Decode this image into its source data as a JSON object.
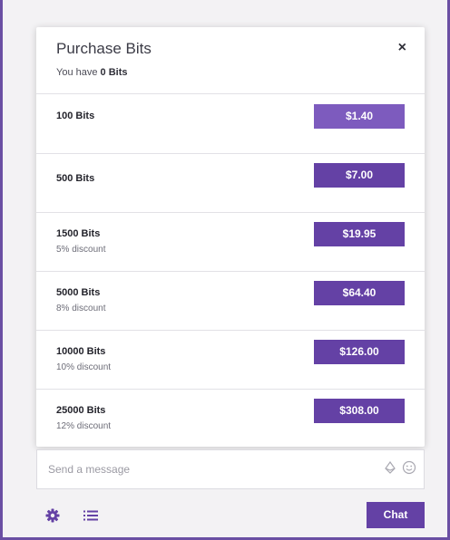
{
  "modal": {
    "title": "Purchase Bits",
    "balance_prefix": "You have",
    "balance_amount": "0 Bits",
    "close_label": "×"
  },
  "tiers": [
    {
      "name": "100 Bits",
      "discount": "",
      "price": "$1.40"
    },
    {
      "name": "500 Bits",
      "discount": "",
      "price": "$7.00"
    },
    {
      "name": "1500 Bits",
      "discount": "5% discount",
      "price": "$19.95"
    },
    {
      "name": "5000 Bits",
      "discount": "8% discount",
      "price": "$64.40"
    },
    {
      "name": "10000 Bits",
      "discount": "10% discount",
      "price": "$126.00"
    },
    {
      "name": "25000 Bits",
      "discount": "12% discount",
      "price": "$308.00"
    }
  ],
  "chat": {
    "placeholder": "Send a message",
    "button_label": "Chat"
  },
  "icons": {
    "close": "close-icon",
    "bits": "bits-icon",
    "emoji": "emoji-icon",
    "settings": "gear-icon",
    "viewer_list": "list-icon"
  },
  "colors": {
    "accent": "#6441a5",
    "accent_light": "#7d5bbe",
    "frame": "#6a4fa3"
  }
}
